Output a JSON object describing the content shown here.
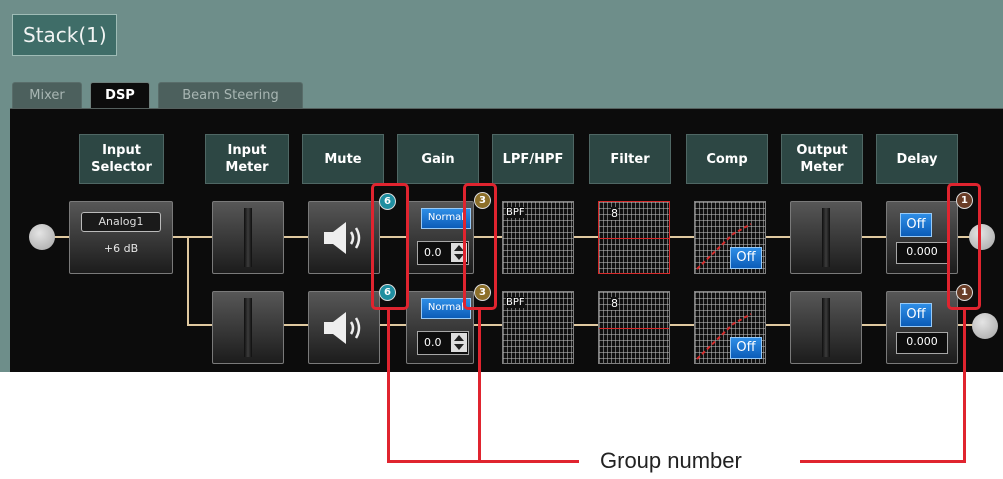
{
  "window": {
    "title": "Stack(1)"
  },
  "tabs": [
    {
      "label": "Mixer",
      "active": false
    },
    {
      "label": "DSP",
      "active": true
    },
    {
      "label": "Beam Steering",
      "active": false
    }
  ],
  "headers": {
    "input_selector": "Input\nSelector",
    "input_meter": "Input\nMeter",
    "mute": "Mute",
    "gain": "Gain",
    "lpf_hpf": "LPF/HPF",
    "filter": "Filter",
    "comp": "Comp",
    "output_meter": "Output\nMeter",
    "delay": "Delay"
  },
  "input_selector": {
    "source": "Analog1",
    "level": "+6 dB"
  },
  "channels": [
    {
      "mute_group": "6",
      "gain_mode": "Normal",
      "gain_value": "0.0",
      "gain_group": "3",
      "lpf_hpf_label": "BPF",
      "filter_label": "8",
      "comp_state": "Off",
      "delay_state": "Off",
      "delay_value": "0.000",
      "delay_group": "1"
    },
    {
      "mute_group": "6",
      "gain_mode": "Normal",
      "gain_value": "0.0",
      "gain_group": "3",
      "lpf_hpf_label": "BPF",
      "filter_label": "8",
      "comp_state": "Off",
      "delay_state": "Off",
      "delay_value": "0.000",
      "delay_group": "1"
    }
  ],
  "annotation": {
    "label": "Group number"
  },
  "colors": {
    "frame": "#6e8e8a",
    "panel": "#0c0c0c",
    "header_bg": "#2d4744",
    "wire": "#e0c9a0",
    "button_blue": "#1c72d0",
    "callout_red": "#e0242f",
    "filter_curve": "#d82a2a"
  }
}
